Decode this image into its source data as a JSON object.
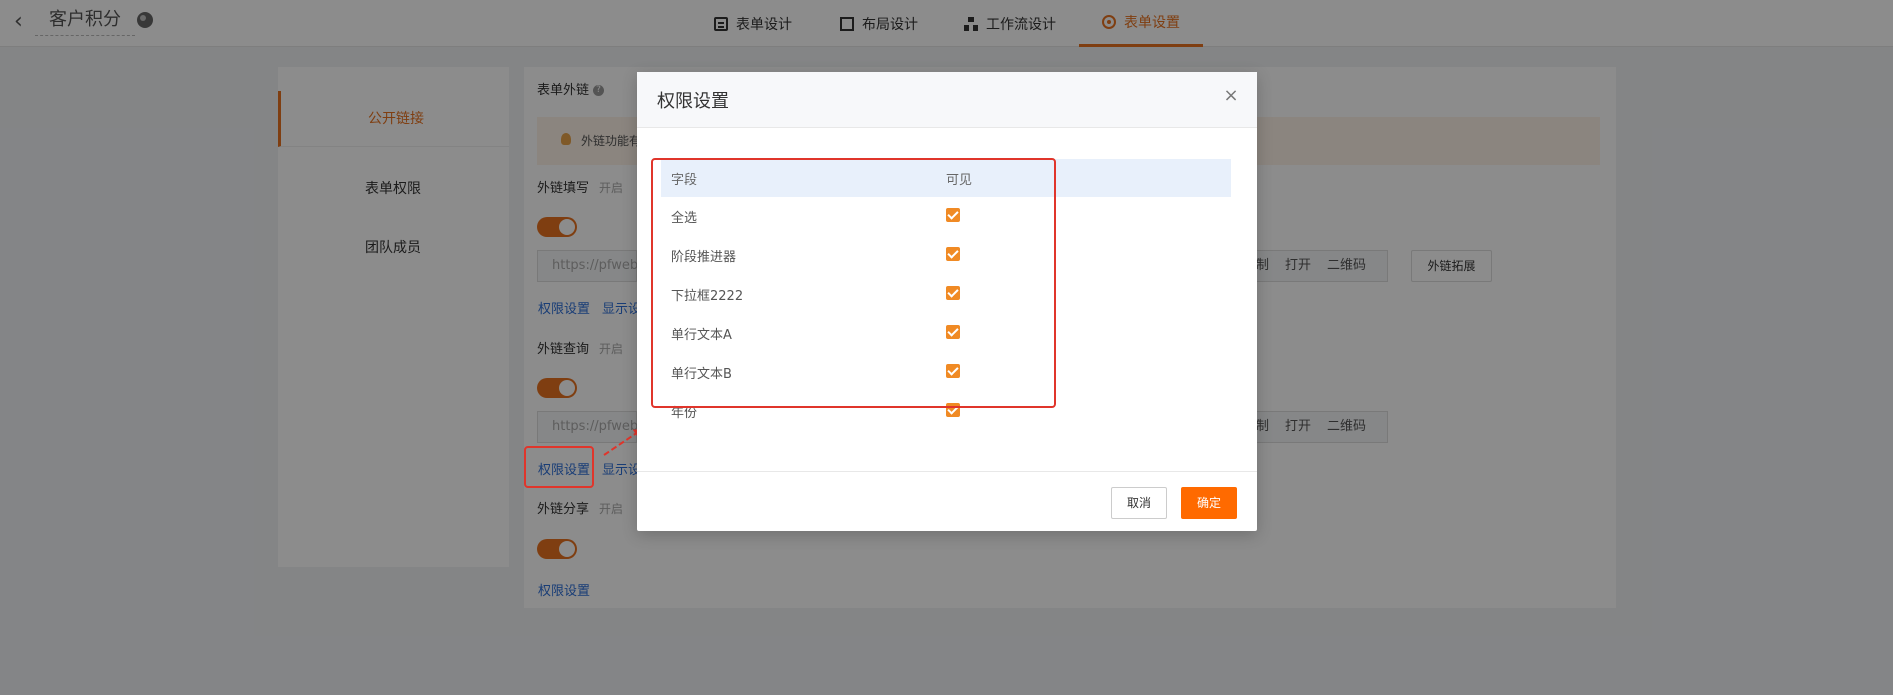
{
  "header": {
    "app_title": "客户积分",
    "tabs": [
      {
        "label": "表单设计"
      },
      {
        "label": "布局设计"
      },
      {
        "label": "工作流设计"
      },
      {
        "label": "表单设置"
      }
    ]
  },
  "left_nav": {
    "items": [
      {
        "label": "公开链接"
      },
      {
        "label": "表单权限"
      },
      {
        "label": "团队成员"
      }
    ]
  },
  "main": {
    "section_title": "表单外链",
    "notice_text": "外链功能有",
    "fill": {
      "label": "外链填写",
      "hint": "开启",
      "url": "https://pfweb.x",
      "ops": [
        "制",
        "打开",
        "二维码"
      ],
      "ext_button": "外链拓展",
      "perm_link": "权限设置",
      "display_link": "显示设"
    },
    "query": {
      "label": "外链查询",
      "hint": "开启",
      "url": "https://pfweb.x",
      "ops": [
        "制",
        "打开",
        "二维码"
      ],
      "perm_link": "权限设置",
      "display_link": "显示设"
    },
    "share": {
      "label": "外链分享",
      "hint": "开启",
      "perm_link": "权限设置"
    }
  },
  "modal": {
    "title": "权限设置",
    "columns": {
      "field": "字段",
      "visible": "可见"
    },
    "rows": [
      {
        "field": "全选",
        "visible": true
      },
      {
        "field": "阶段推进器",
        "visible": true
      },
      {
        "field": "下拉框2222",
        "visible": true
      },
      {
        "field": "单行文本A",
        "visible": true
      },
      {
        "field": "单行文本B",
        "visible": true
      },
      {
        "field": "年份",
        "visible": true
      }
    ],
    "cancel_label": "取消",
    "ok_label": "确定"
  },
  "colors": {
    "accent": "#e8721f",
    "primary_button": "#ff6a00",
    "link": "#2e6fd8",
    "annotation": "#e0352b"
  }
}
